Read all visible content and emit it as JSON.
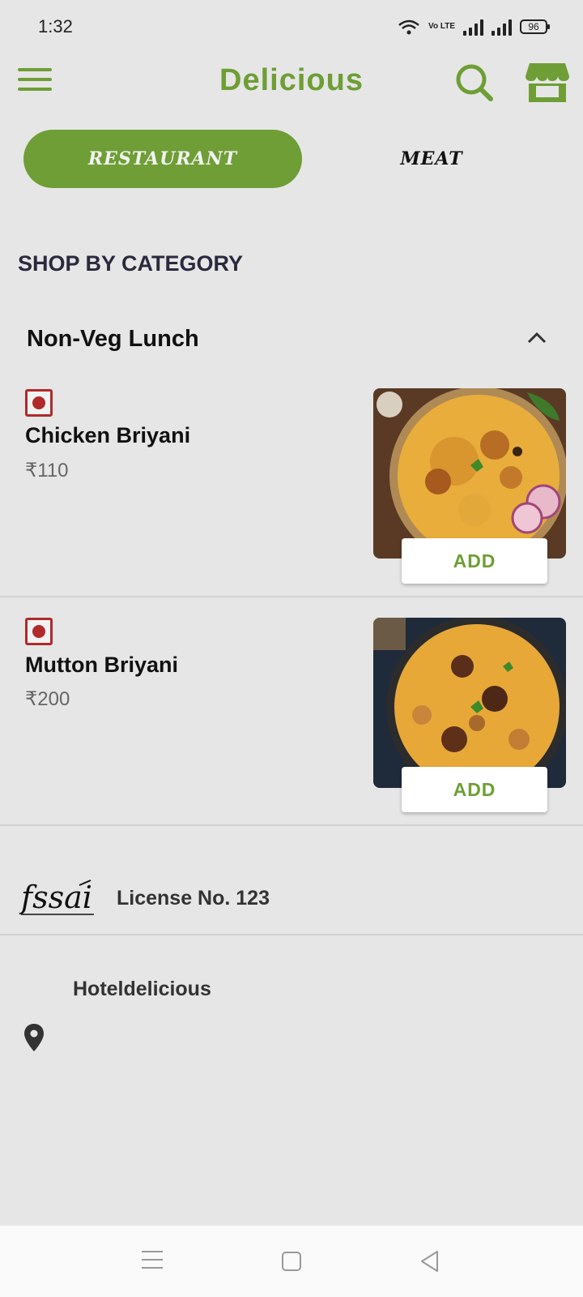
{
  "status_bar": {
    "time": "1:32",
    "network": "Vo LTE",
    "battery": "96"
  },
  "header": {
    "title": "Delicious",
    "icons": {
      "menu": "hamburger-menu-icon",
      "search": "search-icon",
      "store": "store-icon"
    }
  },
  "tabs": [
    {
      "label": "RESTAURANT",
      "active": true
    },
    {
      "label": "MEAT",
      "active": false
    }
  ],
  "shop_by_category": "SHOP BY CATEGORY",
  "category": {
    "title": "Non-Veg Lunch",
    "expanded": true
  },
  "items": [
    {
      "name": "Chicken Briyani",
      "price": "₹110",
      "add_label": "ADD",
      "type": "non-veg"
    },
    {
      "name": "Mutton Briyani",
      "price": "₹200",
      "add_label": "ADD",
      "type": "non-veg"
    }
  ],
  "footer": {
    "fssai_logo": "fssai",
    "license": "License No. 123",
    "hotel_name": "Hoteldelicious",
    "location_icon": "map-pin-icon"
  },
  "colors": {
    "brand_green": "#6e9e35",
    "nonveg_red": "#b02a2a",
    "background": "#e6e6e6"
  }
}
